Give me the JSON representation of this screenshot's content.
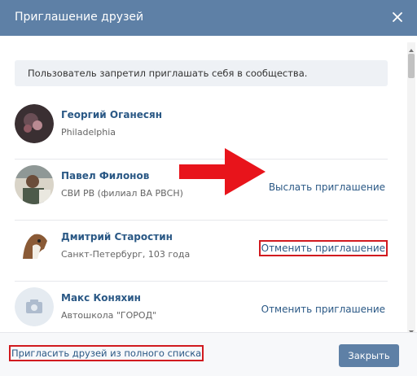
{
  "header": {
    "title": "Приглашение друзей",
    "close_icon": "close-icon"
  },
  "notice": {
    "text": "Пользователь запретил приглашать себя в сообщества."
  },
  "friends": [
    {
      "name": "Георгий Оганесян",
      "subtitle": "Philadelphia",
      "action": ""
    },
    {
      "name": "Павел Филонов",
      "subtitle": "СВИ РВ (филиал ВА РВСН)",
      "action": "Выслать приглашение"
    },
    {
      "name": "Дмитрий Старостин",
      "subtitle": "Санкт-Петербург, 103 года",
      "action": "Отменить приглашение"
    },
    {
      "name": "Макс Коняхин",
      "subtitle": "Автошкола \"ГОРОД\"",
      "action": "Отменить приглашение"
    }
  ],
  "footer": {
    "invite_all_link": "Пригласить друзей из полного списка",
    "close_button": "Закрыть"
  },
  "colors": {
    "header_bg": "#5e80a6",
    "link": "#2a5885",
    "highlight": "#d11a1f"
  }
}
